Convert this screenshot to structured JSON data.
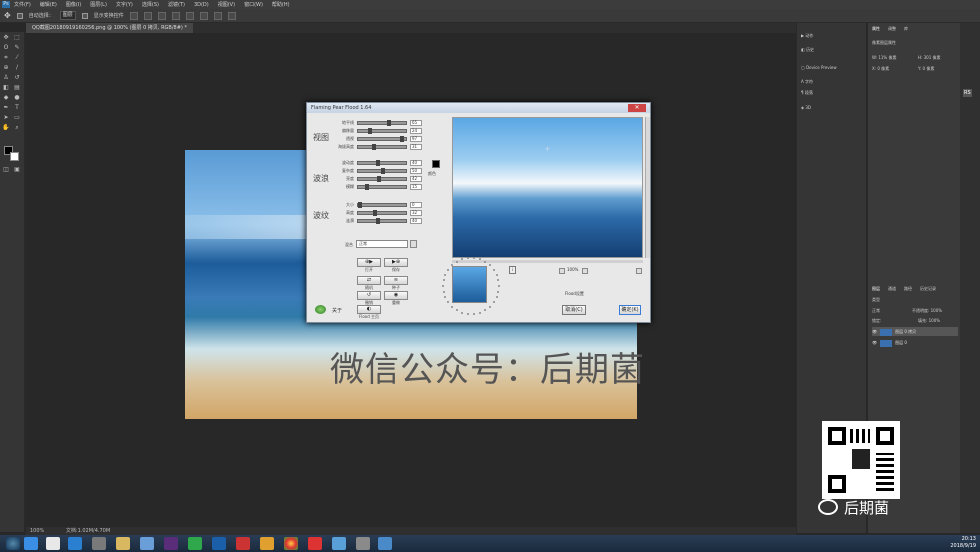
{
  "menu": {
    "logo": "Ps",
    "items": [
      "文件(F)",
      "编辑(E)",
      "图像(I)",
      "图层(L)",
      "文字(Y)",
      "选择(S)",
      "滤镜(T)",
      "3D(D)",
      "视图(V)",
      "窗口(W)",
      "帮助(H)"
    ]
  },
  "options": {
    "auto_select_label": "自动选择：",
    "auto_select_value": "图层",
    "show_transform_label": "显示变换控件"
  },
  "document_tab": "QQ截图20180919160256.png @ 100% (图层 0 拷贝, RGB/8#) *",
  "status": {
    "zoom": "100%",
    "doc_size": "文档:1.02M/4.70M"
  },
  "dialog": {
    "title": "Flaming Pear Flood 1.64",
    "close_label": "✕",
    "groups": [
      "视图",
      "波浪",
      "波纹"
    ],
    "sliders": [
      {
        "label": "地平线",
        "value": 65,
        "frac": 0.62
      },
      {
        "label": "偏移量",
        "value": 24,
        "frac": 0.22
      },
      {
        "label": "透视",
        "value": 97,
        "frac": 0.92
      },
      {
        "label": "海拔高度",
        "value": 31,
        "frac": 0.3
      },
      {
        "label": "波动度",
        "value": 40,
        "frac": 0.4
      },
      {
        "label": "复杂度",
        "value": 50,
        "frac": 0.5
      },
      {
        "label": "亮度",
        "value": 42,
        "frac": 0.42
      },
      {
        "label": "模糊",
        "value": 15,
        "frac": 0.15
      },
      {
        "label": "大小",
        "value": 0,
        "frac": 0.0
      },
      {
        "label": "高度",
        "value": 32,
        "frac": 0.32
      },
      {
        "label": "涟漪",
        "value": 40,
        "frac": 0.4
      }
    ],
    "color_label": "颜色",
    "glue_label": "混合",
    "glue_value": "正常",
    "preset_buttons": [
      {
        "glyph": "⊕▶",
        "caption": "打开"
      },
      {
        "glyph": "▶⊕",
        "caption": "保存"
      },
      {
        "glyph": "⇄",
        "caption": "随机"
      },
      {
        "glyph": "≋",
        "caption": "种子"
      },
      {
        "glyph": "↺",
        "caption": "撤销"
      },
      {
        "glyph": "◉",
        "caption": "重做"
      },
      {
        "glyph": "◐",
        "caption": "Flood 主页"
      }
    ],
    "about_label": "关于",
    "zoom_label": "100%",
    "preview_label": "Flood设置",
    "cancel_label": "取消(C)",
    "ok_label": "确定(K)"
  },
  "canvas": {
    "watermark": "微信公众号：后期菌"
  },
  "dock": {
    "items": [
      "动作",
      "历史",
      "Device Preview",
      "字符",
      "段落",
      "3D"
    ]
  },
  "properties": {
    "tabs": [
      "属性",
      "调整",
      "库"
    ],
    "title": "像素图层属性",
    "w_label": "W: 11% 像素",
    "h_label": "H: 301 像素",
    "x_label": "X: 0 像素",
    "y_label": "Y: 0 像素"
  },
  "layers": {
    "tabs": [
      "图层",
      "通道",
      "路径",
      "历史记录"
    ],
    "kind_label": "类型",
    "mode": "正常",
    "opacity": "不透明度: 100%",
    "lock_label": "锁定:",
    "fill": "填充: 100%",
    "rows": [
      "图层 0 拷贝",
      "图层 0"
    ]
  },
  "branding": {
    "wechat_name": "后期菌"
  },
  "taskbar": {
    "time": "20:13",
    "date": "2018/9/19"
  },
  "colors": {
    "ps_blue": "#2b6ea6",
    "dialog_bg": "#e8e8e8",
    "sea_deep": "#143e72"
  }
}
